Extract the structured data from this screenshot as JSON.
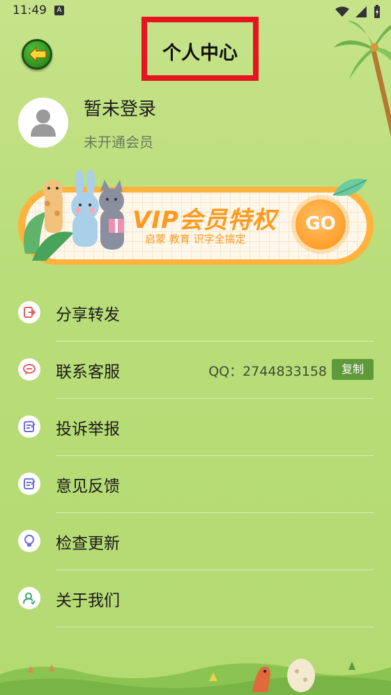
{
  "status_bar": {
    "time": "11:49",
    "notification_glyph": "A"
  },
  "header": {
    "title": "个人中心"
  },
  "profile": {
    "login_title": "暂未登录",
    "member_status": "未开通会员"
  },
  "vip_banner": {
    "title": "VIP会员特权",
    "subtitle": "启蒙 教育 识字全搞定",
    "go_label": "GO"
  },
  "menu": {
    "items": [
      {
        "label": "分享转发",
        "icon": "share-icon"
      },
      {
        "label": "联系客服",
        "icon": "chat-icon"
      },
      {
        "label": "投诉举报",
        "icon": "report-icon"
      },
      {
        "label": "意见反馈",
        "icon": "feedback-icon"
      },
      {
        "label": "检查更新",
        "icon": "lightbulb-icon"
      },
      {
        "label": "关于我们",
        "icon": "user-icon"
      }
    ],
    "qq_text": "QQ：2744833158",
    "copy_label": "复制"
  },
  "colors": {
    "background": "#bcdd7c",
    "accent_orange": "#ffb23c",
    "copy_green": "#5f9a3a",
    "title_outline_red": "#e5141e"
  }
}
